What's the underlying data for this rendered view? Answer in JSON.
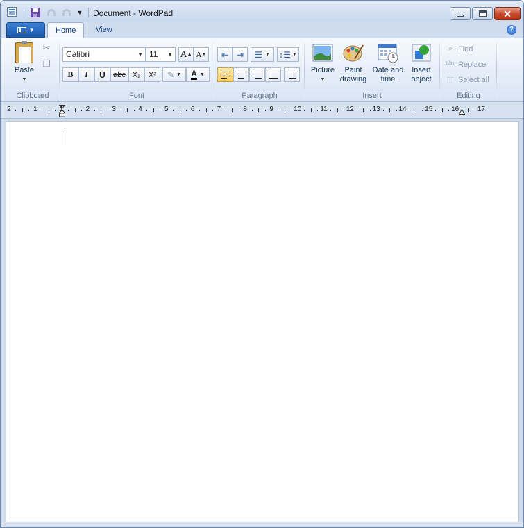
{
  "window": {
    "title": "Document - WordPad"
  },
  "tabs": [
    {
      "label": "Home"
    },
    {
      "label": "View"
    }
  ],
  "ribbon": {
    "clipboard": {
      "label": "Clipboard",
      "paste_label": "Paste"
    },
    "font": {
      "label": "Font",
      "family": "Calibri",
      "size": "11",
      "bold": "B",
      "italic": "I",
      "underline": "U",
      "strike": "abc",
      "sub": "X₂",
      "sup": "X²",
      "grow": "A",
      "shrink": "A",
      "color": "A"
    },
    "paragraph": {
      "label": "Paragraph"
    },
    "insert": {
      "label": "Insert",
      "picture": "Picture",
      "paint_1": "Paint",
      "paint_2": "drawing",
      "date_1": "Date and",
      "date_2": "time",
      "object_1": "Insert",
      "object_2": "object"
    },
    "editing": {
      "label": "Editing",
      "find": "Find",
      "replace": "Replace",
      "select_all": "Select all"
    }
  },
  "ruler": {
    "numbers": [
      "2",
      "1",
      "1",
      "2",
      "3",
      "4",
      "5",
      "6",
      "7",
      "8",
      "9",
      "10",
      "11",
      "12",
      "13",
      "14",
      "15",
      "16",
      "17"
    ]
  },
  "colors": {
    "accent": "#1c58ad",
    "highlight": "#f9cd5d",
    "font_color": "#000000"
  }
}
